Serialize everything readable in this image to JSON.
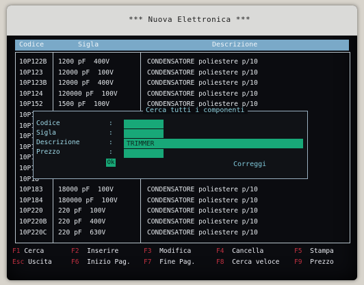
{
  "title_bar": "*** Nuova Elettronica ***",
  "columns": [
    "Codice",
    "Sigla",
    "Descrizione"
  ],
  "rows": [
    {
      "codice": "10P122B",
      "sigla": "1200 pF  400V",
      "descrizione": "CONDENSATORE poliestere p/10"
    },
    {
      "codice": "10P123",
      "sigla": "12000 pF  100V",
      "descrizione": "CONDENSATORE poliestere p/10"
    },
    {
      "codice": "10P123B",
      "sigla": "12000 pF  400V",
      "descrizione": "CONDENSATORE poliestere p/10"
    },
    {
      "codice": "10P124",
      "sigla": "120000 pF  100V",
      "descrizione": "CONDENSATORE poliestere p/10"
    },
    {
      "codice": "10P152",
      "sigla": "1500 pF  100V",
      "descrizione": "CONDENSATORE poliestere p/10"
    },
    {
      "codice": "10P15",
      "sigla": "",
      "descrizione": ""
    },
    {
      "codice": "10P15",
      "sigla": "",
      "descrizione": ""
    },
    {
      "codice": "10P15",
      "sigla": "",
      "descrizione": ""
    },
    {
      "codice": "10P15",
      "sigla": "",
      "descrizione": ""
    },
    {
      "codice": "10P15",
      "sigla": "",
      "descrizione": ""
    },
    {
      "codice": "10P18",
      "sigla": "",
      "descrizione": ""
    },
    {
      "codice": "10P18",
      "sigla": "",
      "descrizione": ""
    },
    {
      "codice": "10P183",
      "sigla": "18000 pF  100V",
      "descrizione": "CONDENSATORE poliestere p/10"
    },
    {
      "codice": "10P184",
      "sigla": "180000 pF  100V",
      "descrizione": "CONDENSATORE poliestere p/10"
    },
    {
      "codice": "10P220",
      "sigla": "220 pF  100V",
      "descrizione": "CONDENSATORE poliestere p/10"
    },
    {
      "codice": "10P220B",
      "sigla": "220 pF  400V",
      "descrizione": "CONDENSATORE poliestere p/10"
    },
    {
      "codice": "10P220C",
      "sigla": "220 pF  630V",
      "descrizione": "CONDENSATORE poliestere p/10"
    }
  ],
  "dialog": {
    "title": "Cerca tutti i componenti",
    "labels": [
      "Codice",
      "Sigla",
      "Descrizione",
      "Prezzo"
    ],
    "descrizione_value": "TRIMMER",
    "ok_label": "Ok",
    "correggi_label": "Correggi"
  },
  "function_keys": [
    {
      "key": "F1",
      "label": "Cerca"
    },
    {
      "key": "F2",
      "label": "Inserire"
    },
    {
      "key": "F3",
      "label": "Modifica"
    },
    {
      "key": "F4",
      "label": "Cancella"
    },
    {
      "key": "F5",
      "label": "Stampa"
    },
    {
      "key": "Esc",
      "label": "Uscita"
    },
    {
      "key": "F6",
      "label": "Inizio Pag."
    },
    {
      "key": "F7",
      "label": "Fine Pag."
    },
    {
      "key": "F8",
      "label": "Cerca veloce"
    },
    {
      "key": "F9",
      "label": "Prezzo"
    }
  ],
  "colors": {
    "header_bar": "#7aa9c8",
    "field_green": "#18a878",
    "function_key_red": "#c03040"
  }
}
